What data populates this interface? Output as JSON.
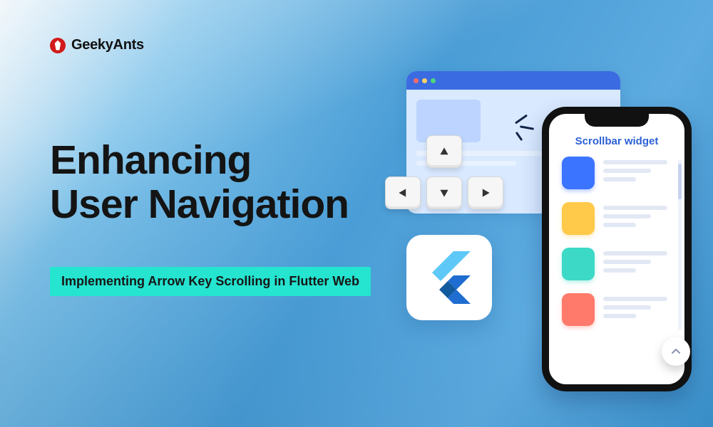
{
  "brand": {
    "name": "GeekyAnts"
  },
  "headline": {
    "line1": "Enhancing",
    "line2": "User Navigation"
  },
  "subtitle": "Implementing Arrow Key Scrolling in Flutter Web",
  "phone": {
    "title": "Scrollbar widget",
    "items": [
      {
        "color": "blue"
      },
      {
        "color": "gold"
      },
      {
        "color": "teal"
      },
      {
        "color": "coral"
      }
    ]
  },
  "arrow_keys": [
    "up",
    "left",
    "down",
    "right"
  ],
  "colors": {
    "accent": "#25e4d0",
    "flutter_blue": "#1f6dd0"
  }
}
